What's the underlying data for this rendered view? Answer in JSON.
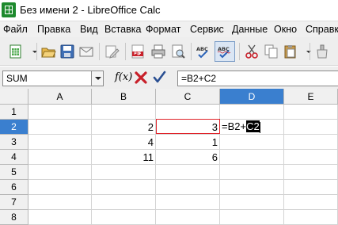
{
  "window": {
    "title": "Без имени 2 - LibreOffice Calc"
  },
  "menubar": {
    "items": [
      "Файл",
      "Правка",
      "Вид",
      "Вставка",
      "Формат",
      "Сервис",
      "Данные",
      "Окно",
      "Справка"
    ]
  },
  "toolbar": {
    "buttons": [
      "new-icon",
      "open-icon",
      "save-icon",
      "email-icon",
      "edit-file-icon",
      "export-pdf-icon",
      "print-icon",
      "print-preview-icon",
      "spellcheck-icon",
      "autospellcheck-icon",
      "cut-icon",
      "copy-icon",
      "paste-icon",
      "clone-formatting-icon"
    ],
    "toggled": "autospellcheck-icon"
  },
  "formula_bar": {
    "name_box": "SUM",
    "function_wizard_label": "f(x)",
    "input": "=B2+C2"
  },
  "sheet": {
    "columns": [
      "A",
      "B",
      "C",
      "D",
      "E"
    ],
    "selected_column": "D",
    "rows": [
      "1",
      "2",
      "3",
      "4",
      "5",
      "6",
      "7",
      "8"
    ],
    "selected_row": "2",
    "cells": {
      "B2": "2",
      "C2": "3",
      "B3": "4",
      "C3": "1",
      "B4": "11",
      "C4": "6"
    },
    "editing": {
      "cell": "D2",
      "prefix": "=B2+",
      "highlighted": "C2"
    },
    "colors": {
      "reference_border": "#e0232a",
      "selection_header": "#3a7fcf"
    }
  }
}
